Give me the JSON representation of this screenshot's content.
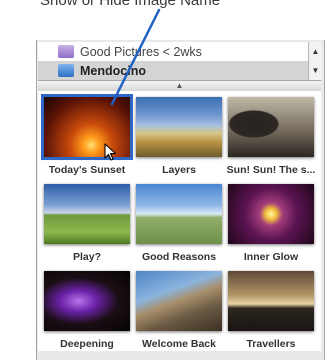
{
  "caption": "Show or Hide Image Name",
  "source_list": {
    "items": [
      {
        "label": "Good Pictures < 2wks",
        "icon": "smart-album-icon",
        "selected": false
      },
      {
        "label": "Mendocino",
        "icon": "album-icon",
        "selected": true
      }
    ],
    "scroll_up": "▲",
    "scroll_down": "▼"
  },
  "divider_glyph": "▲",
  "photos": [
    {
      "title": "Today's Sunset",
      "selected": true
    },
    {
      "title": "Layers",
      "selected": false
    },
    {
      "title": "Sun! Sun! The s...",
      "selected": false
    },
    {
      "title": "Play?",
      "selected": false
    },
    {
      "title": "Good Reasons",
      "selected": false
    },
    {
      "title": "Inner Glow",
      "selected": false
    },
    {
      "title": "Deepening",
      "selected": false
    },
    {
      "title": "Welcome Back",
      "selected": false
    },
    {
      "title": "Travellers",
      "selected": false
    }
  ],
  "colors": {
    "selection_border": "#2f67c4",
    "pointer_line": "#2160c4"
  }
}
